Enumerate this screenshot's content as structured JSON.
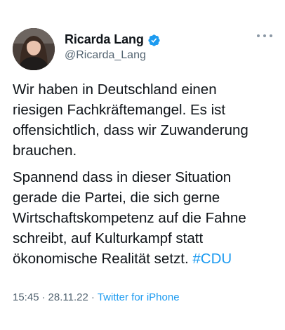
{
  "author": {
    "name": "Ricarda Lang",
    "handle": "@Ricarda_Lang",
    "verified_icon": "verified-badge-icon",
    "verified_color": "#1d9bf0"
  },
  "menu_icon": "more-options-icon",
  "body": {
    "paragraph_1": [
      "Wir haben in Deutschland einen",
      "riesigen Fachkräftemangel. Es ist",
      "offensichtlich, dass wir Zuwanderung",
      "brauchen."
    ],
    "paragraph_2": [
      "Spannend dass in dieser Situation",
      "gerade die Partei, die sich gerne",
      "Wirtschaftskompetenz auf die Fahne",
      "schreibt, auf Kulturkampf statt",
      "ökonomische Realität setzt."
    ],
    "hashtag": "#CDU"
  },
  "meta": {
    "time": "15:45",
    "date": "28.11.22",
    "separator": "·",
    "source": "Twitter for iPhone"
  },
  "colors": {
    "text": "#0f1419",
    "secondary": "#536471",
    "link": "#1d9bf0"
  }
}
